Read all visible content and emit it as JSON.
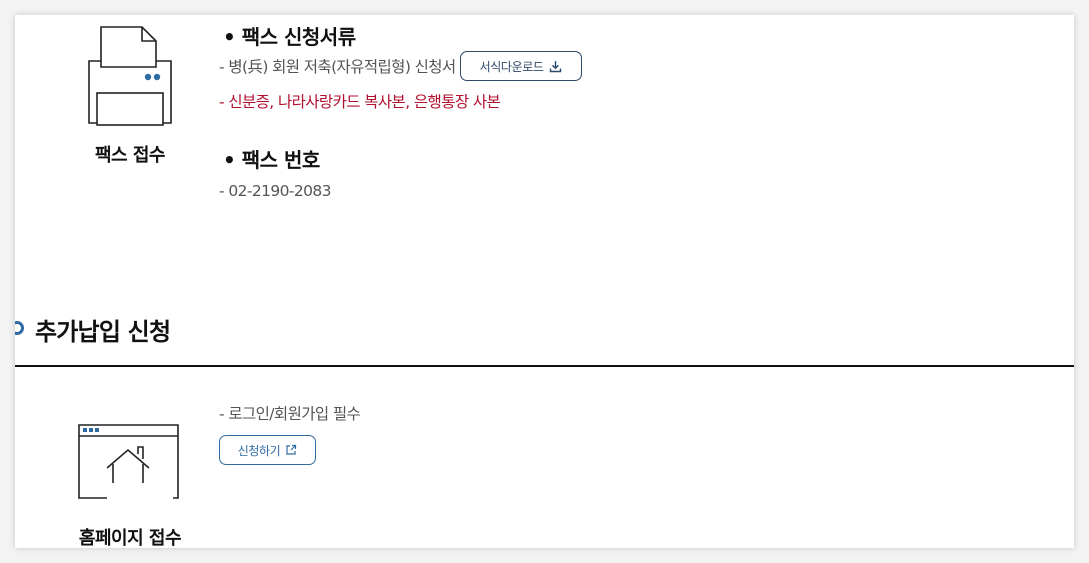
{
  "fax": {
    "label": "팩스 접수",
    "docs_heading": "• 팩스 신청서류",
    "form_line": "- 병(兵) 회원 저축(자유적립형) 신청서",
    "download_button": "서식다운로드",
    "required_docs": "- 신분증, 나라사랑카드 복사본, 은행통장 사본",
    "number_heading": "• 팩스 번호",
    "number": "- 02-2190-2083"
  },
  "additional": {
    "section_title": "추가납입 신청",
    "label": "홈페이지 접수",
    "note": "- 로그인/회원가입 필수",
    "apply_button": "신청하기"
  },
  "colors": {
    "accent_blue": "#2f6aa3",
    "required_red": "#b2102f",
    "icon_dot_blue": "#2f6aa3"
  },
  "icons": {
    "fax": "printer-icon",
    "homepage": "browser-home-icon",
    "download": "download-icon",
    "external": "external-link-icon"
  }
}
